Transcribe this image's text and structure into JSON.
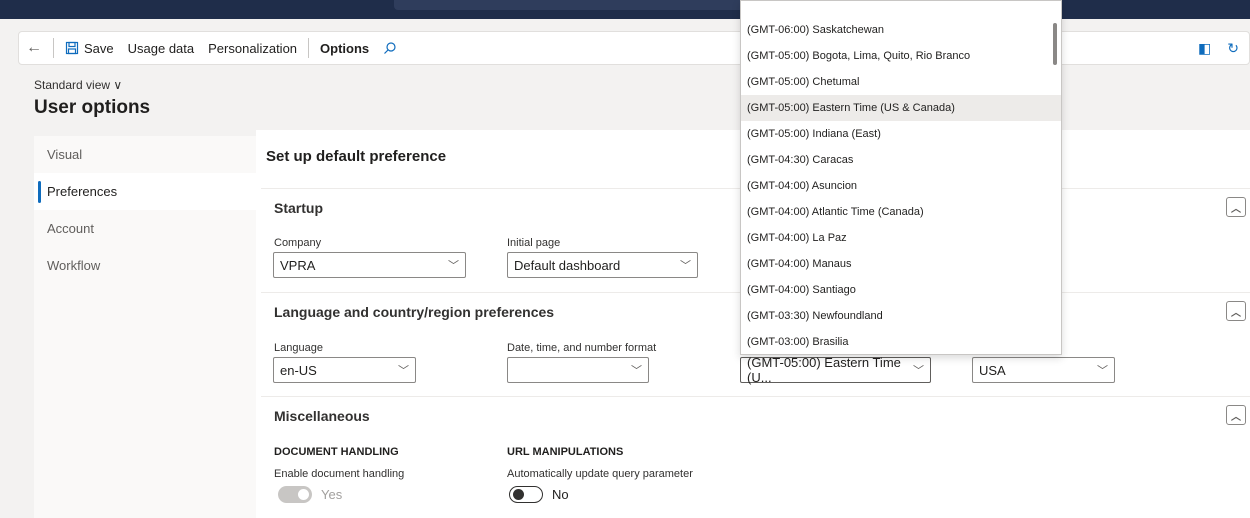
{
  "toolbar": {
    "save_label": "Save",
    "usage_label": "Usage data",
    "personalization_label": "Personalization",
    "options_label": "Options"
  },
  "page": {
    "view_label": "Standard view ∨",
    "title": "User options"
  },
  "sidebar": {
    "items": [
      {
        "label": "Visual"
      },
      {
        "label": "Preferences"
      },
      {
        "label": "Account"
      },
      {
        "label": "Workflow"
      }
    ]
  },
  "main": {
    "title": "Set up default preference",
    "startup": {
      "heading": "Startup",
      "company_label": "Company",
      "company_value": "VPRA",
      "initial_page_label": "Initial page",
      "initial_page_value": "Default dashboard"
    },
    "language": {
      "heading": "Language and country/region preferences",
      "language_label": "Language",
      "language_value": "en-US",
      "format_label": "Date, time, and number format",
      "format_value": "",
      "timezone_value": "(GMT-05:00) Eastern Time (U...",
      "country_value": "USA"
    },
    "misc": {
      "heading": "Miscellaneous",
      "doc_heading": "DOCUMENT HANDLING",
      "doc_toggle_label": "Enable document handling",
      "doc_toggle_value": "Yes",
      "url_heading": "URL MANIPULATIONS",
      "url_toggle_label": "Automatically update query parameter",
      "url_toggle_value": "No"
    }
  },
  "timezone_dropdown": {
    "options": [
      "(GMT-06:00) Saskatchewan",
      "(GMT-05:00) Bogota, Lima, Quito, Rio Branco",
      "(GMT-05:00) Chetumal",
      "(GMT-05:00) Eastern Time (US & Canada)",
      "(GMT-05:00) Indiana (East)",
      "(GMT-04:30) Caracas",
      "(GMT-04:00) Asuncion",
      "(GMT-04:00) Atlantic Time (Canada)",
      "(GMT-04:00) La Paz",
      "(GMT-04:00) Manaus",
      "(GMT-04:00) Santiago",
      "(GMT-03:30) Newfoundland",
      "(GMT-03:00) Brasilia"
    ],
    "highlighted": "(GMT-05:00) Eastern Time (US & Canada)"
  },
  "colors": {
    "accent": "#0f6cbd",
    "topbar": "#1f2d4a"
  }
}
